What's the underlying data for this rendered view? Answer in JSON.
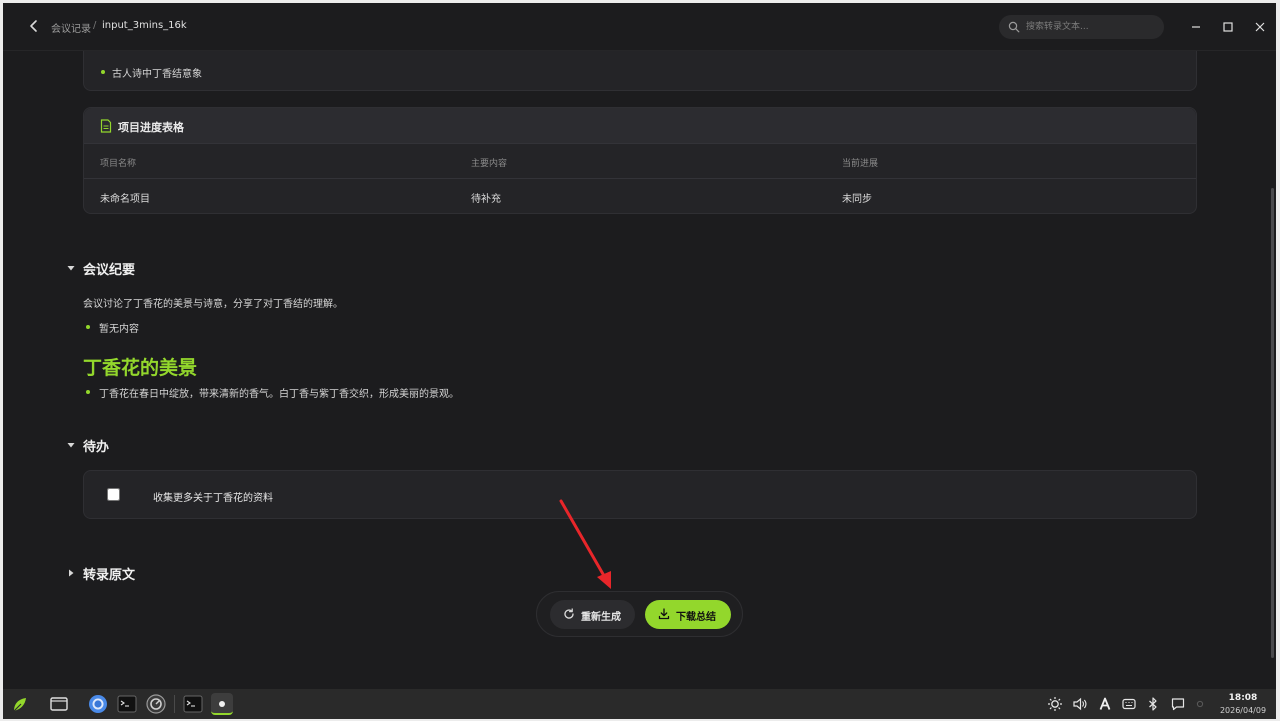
{
  "breadcrumb": {
    "parent": "会议记录",
    "separator": "/",
    "current": "input_3mins_16k"
  },
  "search": {
    "placeholder": "搜索转录文本..."
  },
  "keywords": {
    "items": [
      "古人诗中丁香结意象"
    ]
  },
  "progress_table": {
    "title": "项目进度表格",
    "headers": [
      "项目名称",
      "主要内容",
      "当前进展"
    ],
    "rows": [
      [
        "未命名项目",
        "待补充",
        "未同步"
      ]
    ]
  },
  "summary": {
    "title": "会议纪要",
    "intro": "会议讨论了丁香花的美景与诗意，分享了对丁香结的理解。",
    "bullet": "暂无内容",
    "heading": "丁香花的美景",
    "heading_bullet": "丁香花在春日中绽放，带来清新的香气。白丁香与紫丁香交织，形成美丽的景观。"
  },
  "todo": {
    "title": "待办",
    "items": [
      {
        "text": "收集更多关于丁香花的资料",
        "checked": false
      }
    ]
  },
  "transcript": {
    "title": "转录原文"
  },
  "actions": {
    "regenerate": "重新生成",
    "download": "下载总结"
  },
  "clock": {
    "time": "18:08",
    "date": "2026/04/09"
  },
  "colors": {
    "accent": "#93d72c",
    "background": "#1c1c1e",
    "card": "#242427"
  }
}
